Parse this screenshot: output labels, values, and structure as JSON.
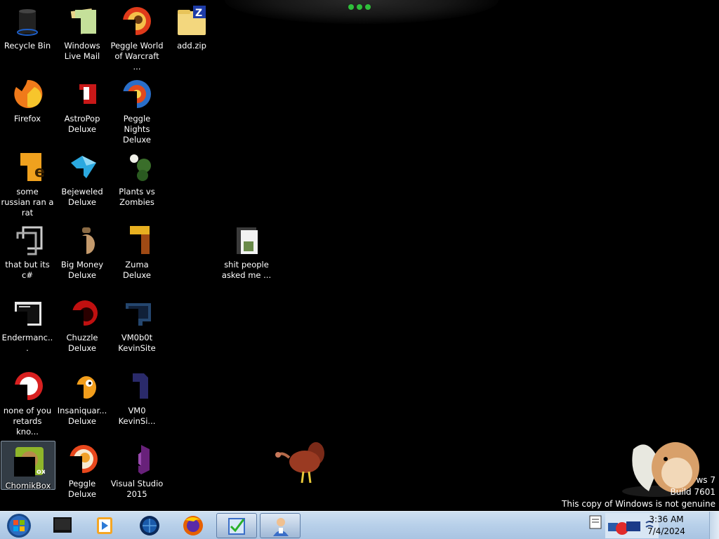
{
  "desktop": {
    "icons": [
      {
        "label": "Recycle Bin",
        "icon": "recycle-bin-icon"
      },
      {
        "label": "Windows Live Mail",
        "icon": "windows-live-mail-icon"
      },
      {
        "label": "Peggle World of Warcraft ...",
        "icon": "peggle-wow-icon"
      },
      {
        "label": "add.zip",
        "icon": "zip-folder-icon"
      },
      {
        "label": "Firefox",
        "icon": "firefox-icon"
      },
      {
        "label": "AstroPop Deluxe",
        "icon": "astropop-icon"
      },
      {
        "label": "Peggle Nights Deluxe",
        "icon": "peggle-nights-icon"
      },
      {
        "label": "some russian ran a rat",
        "icon": "file-e-icon"
      },
      {
        "label": "Bejeweled Deluxe",
        "icon": "bejeweled-icon"
      },
      {
        "label": "Plants vs Zombies",
        "icon": "plants-vs-zombies-icon"
      },
      {
        "label": "that but its c#",
        "icon": "copy-shortcut-icon"
      },
      {
        "label": "Big Money Deluxe",
        "icon": "big-money-icon"
      },
      {
        "label": "Zuma Deluxe",
        "icon": "zuma-icon"
      },
      {
        "label": "shit people asked me ...",
        "icon": "folder-icon"
      },
      {
        "label": "Endermanc...",
        "icon": "window-app-icon"
      },
      {
        "label": "Chuzzle Deluxe",
        "icon": "chuzzle-icon"
      },
      {
        "label": "VM0b0t KevinSite",
        "icon": "vm-monitor-icon"
      },
      {
        "label": "none of you retards kno...",
        "icon": "red-circle-icon"
      },
      {
        "label": "Insaniquar... Deluxe",
        "icon": "insaniquarium-icon"
      },
      {
        "label": "VM0 KevinSi...",
        "icon": "vm-document-icon"
      },
      {
        "label": "ChomikBox",
        "icon": "chomikbox-icon"
      },
      {
        "label": "Peggle Deluxe",
        "icon": "peggle-icon"
      },
      {
        "label": "Visual Studio 2015",
        "icon": "visual-studio-icon"
      }
    ]
  },
  "watermark": {
    "line1": "ws 7",
    "line2": "Build 7601",
    "line3": "This copy of Windows is not genuine"
  },
  "taskbar": {
    "start": "start-orb-icon",
    "pinned": [
      {
        "icon": "monitor-app-icon"
      },
      {
        "icon": "media-player-icon"
      },
      {
        "icon": "globe-app-icon"
      },
      {
        "icon": "firefox-taskbar-icon"
      },
      {
        "icon": "checklist-app-icon"
      },
      {
        "icon": "user-app-icon"
      }
    ],
    "clock": {
      "time": "3:36 AM",
      "date": "7/4/2024"
    }
  },
  "colors": {
    "taskbar": "#b9d1ea",
    "desktop": "#000000",
    "selection": "#aac8e6"
  }
}
